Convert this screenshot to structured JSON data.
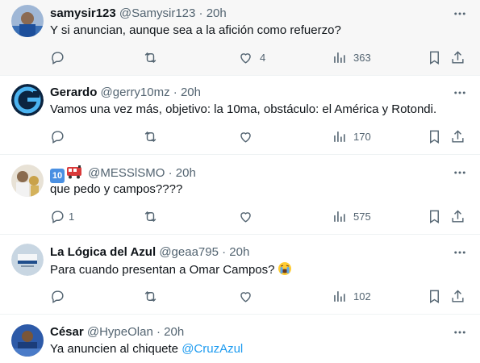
{
  "tweets": [
    {
      "name": "samysir123",
      "handle": "@Samysir123",
      "time": "20h",
      "text": "Y si anuncian, aunque sea a la afición como refuerzo?",
      "replies": "",
      "likes": "4",
      "views": "363"
    },
    {
      "name": "Gerardo",
      "handle": "@gerry10mz",
      "time": "20h",
      "text": "Vamos una vez más, objetivo: la 10ma, obstáculo: el América y Rotondi.",
      "replies": "",
      "likes": "",
      "views": "170"
    },
    {
      "name": "10",
      "handle": "@MESSlSMO",
      "time": "20h",
      "text": "que pedo y campos????",
      "replies": "1",
      "likes": "",
      "views": "575"
    },
    {
      "name": "La Lógica del Azul",
      "handle": "@geaa795",
      "time": "20h",
      "text": "Para cuando presentan a Omar Campos?",
      "replies": "",
      "likes": "",
      "views": "102"
    },
    {
      "name": "César",
      "handle": "@HypeOlan",
      "time": "20h",
      "text": "Ya anuncien al chiquete",
      "mention": "@CruzAzul"
    }
  ],
  "separator": "·",
  "colors": {
    "text": "#0f1419",
    "secondary": "#536471",
    "link": "#1d9bf0",
    "divider": "#eff3f4",
    "highlight": "#f7f7f7"
  }
}
